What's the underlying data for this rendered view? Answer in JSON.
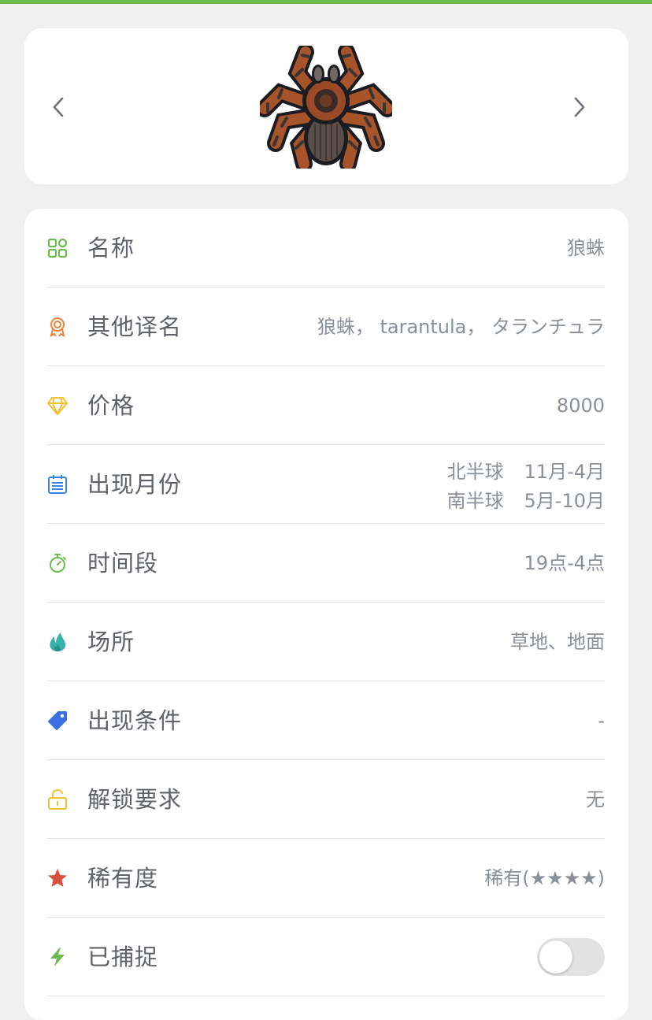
{
  "header": {
    "prev_icon": "chevron-left-icon",
    "next_icon": "chevron-right-icon",
    "image_icon": "tarantula-icon"
  },
  "details": {
    "name": {
      "label": "名称",
      "value": "狼蛛",
      "icon": "grid-icon",
      "color": "#6dbb4e"
    },
    "aliases": {
      "label": "其他译名",
      "value": "狼蛛， tarantula， タランチュラ",
      "icon": "medal-icon",
      "color": "#e8813a"
    },
    "price": {
      "label": "价格",
      "value": "8000",
      "icon": "diamond-icon",
      "color": "#f4c02d"
    },
    "months": {
      "label": "出现月份",
      "north_label": "北半球",
      "north_value": "11月-4月",
      "south_label": "南半球",
      "south_value": "5月-10月",
      "icon": "calendar-icon",
      "color": "#3a84e6"
    },
    "time": {
      "label": "时间段",
      "value": "19点-4点",
      "icon": "stopwatch-icon",
      "color": "#6dbb4e"
    },
    "location": {
      "label": "场所",
      "value": "草地、地面",
      "icon": "flame-icon",
      "color": "#38b2ac"
    },
    "condition": {
      "label": "出现条件",
      "value": "-",
      "icon": "tag-icon",
      "color": "#3a6fe6"
    },
    "unlock": {
      "label": "解锁要求",
      "value": "无",
      "icon": "unlock-icon",
      "color": "#f4c02d"
    },
    "rarity": {
      "label": "稀有度",
      "value": "稀有(★★★★)",
      "icon": "star-icon",
      "color": "#d9503f"
    },
    "caught": {
      "label": "已捕捉",
      "value": false,
      "icon": "lightning-icon",
      "color": "#6dbb4e"
    }
  }
}
